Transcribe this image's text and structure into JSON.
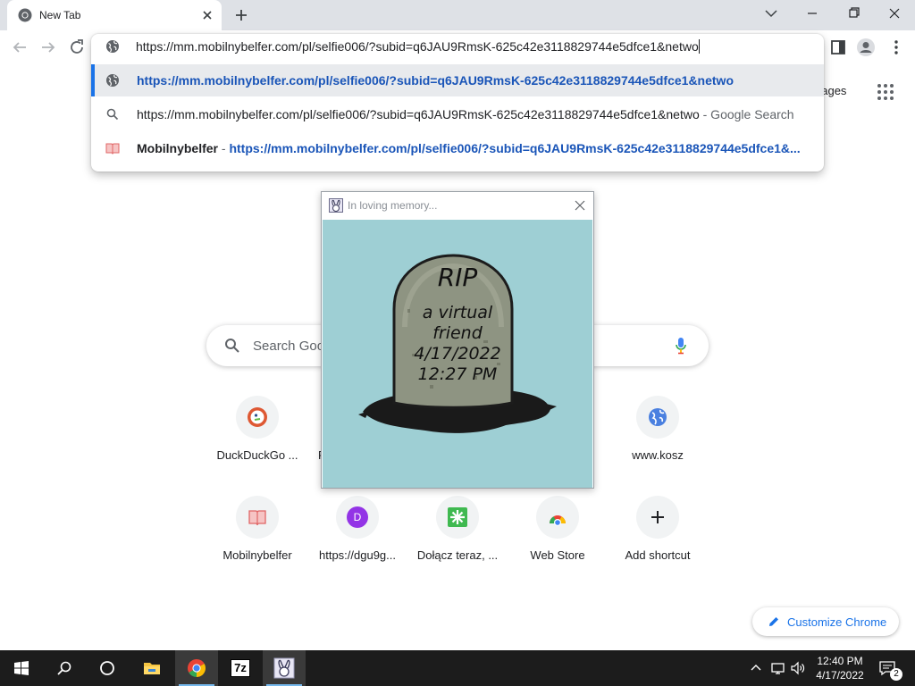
{
  "browser": {
    "tab": {
      "title": "New Tab",
      "icon": "chrome-icon"
    },
    "colors": {
      "accent": "#1a73e8",
      "url_link": "#1a55b8",
      "tabstrip": "#dee1e6"
    }
  },
  "omnibox": {
    "input_value": "https://mm.mobilnybelfer.com/pl/selfie006/?subid=q6JAU9RmsK-625c42e3118829744e5dfce1&netwo",
    "suggestions": [
      {
        "icon": "globe-icon",
        "url": "https://mm.mobilnybelfer.com/pl/selfie006/?subid=q6JAU9RmsK-625c42e3118829744e5dfce1&netwo"
      },
      {
        "icon": "search-icon",
        "text": "https://mm.mobilnybelfer.com/pl/selfie006/?subid=q6JAU9RmsK-625c42e3118829744e5dfce1&netwo",
        "suffix": " - Google Search"
      },
      {
        "icon": "site-icon",
        "site": "Mobilnybelfer",
        "separator": " - ",
        "url": "https://mm.mobilnybelfer.com/pl/selfie006/?subid=q6JAU9RmsK-625c42e3118829744e5dfce1&..."
      }
    ]
  },
  "ntp": {
    "images_link": "nages",
    "search_placeholder": "Search Goo",
    "shortcuts_row1": [
      {
        "label": "DuckDuckGo ...",
        "icon": "duckduckgo-icon"
      },
      {
        "label": "F",
        "icon": ""
      },
      {
        "label": "www.kosz",
        "icon": "globe-icon"
      }
    ],
    "shortcuts_row2": [
      {
        "label": "Mobilnybelfer",
        "icon": "site-icon"
      },
      {
        "label": "https://dgu9g...",
        "icon": "letter-d-icon",
        "letter": "D"
      },
      {
        "label": "Dołącz teraz, ...",
        "icon": "asterisk-icon"
      },
      {
        "label": "Web Store",
        "icon": "webstore-icon"
      },
      {
        "label": "Add shortcut",
        "icon": "plus-icon"
      }
    ],
    "customize_label": "Customize Chrome"
  },
  "popup": {
    "title": "In loving memory...",
    "tomb_line1": "RIP",
    "tomb_line2": "a virtual",
    "tomb_line3": "friend",
    "tomb_line4": "4/17/2022",
    "tomb_line5": "12:27 PM"
  },
  "taskbar": {
    "apps": [
      "start-icon",
      "search-icon",
      "task-view-icon",
      "file-explorer-icon",
      "chrome-icon",
      "7zip-icon",
      "bunny-app-icon"
    ],
    "zip_label": "7z",
    "time": "12:40 PM",
    "date": "4/17/2022",
    "notification_count": "2"
  }
}
